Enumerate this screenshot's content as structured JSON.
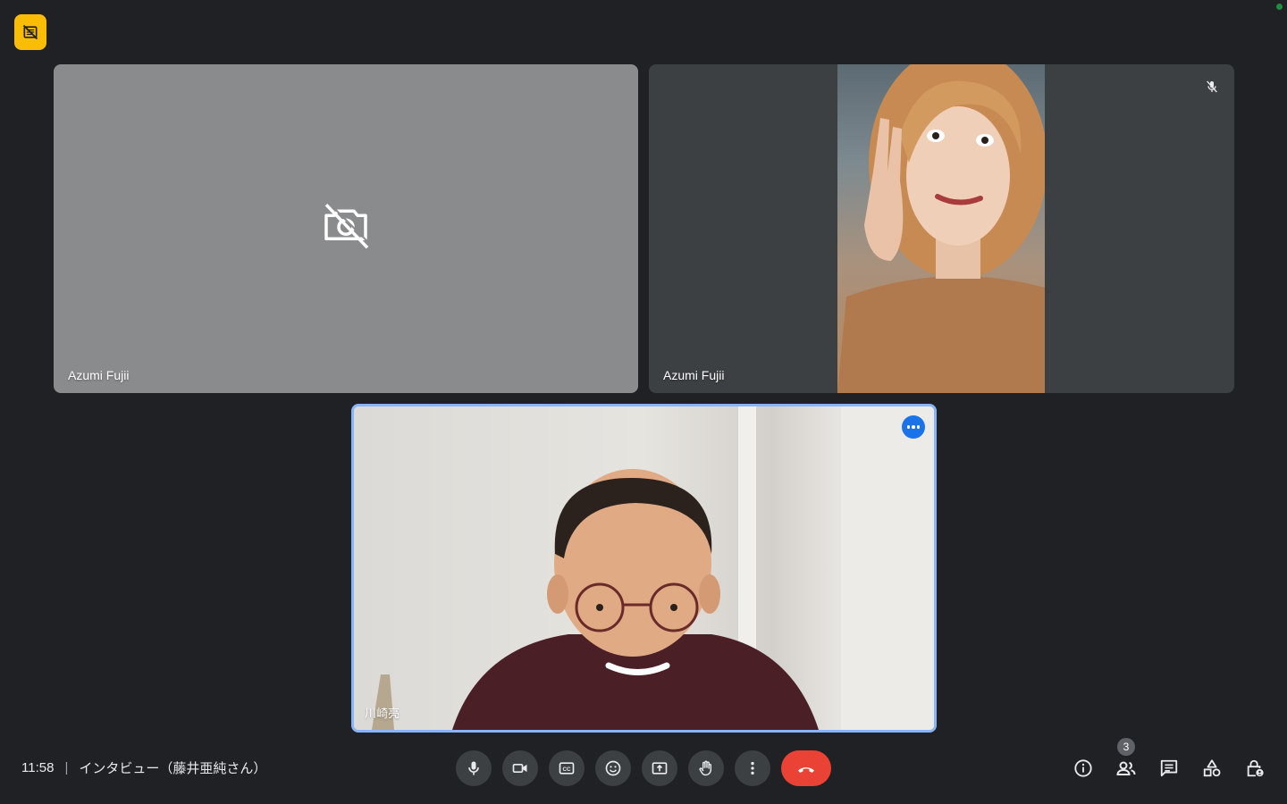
{
  "meeting": {
    "time": "11:58",
    "separator": "|",
    "title": "インタビュー（藤井亜純さん）"
  },
  "tiles": [
    {
      "name": "Azumi Fujii",
      "camera": "off"
    },
    {
      "name": "Azumi Fujii",
      "mic": "muted"
    },
    {
      "name": "川崎亮",
      "active_speaker": true
    }
  ],
  "controls": [
    {
      "name": "microphone",
      "icon": "mic-icon"
    },
    {
      "name": "camera",
      "icon": "videocam-icon"
    },
    {
      "name": "captions",
      "icon": "closed-caption-icon"
    },
    {
      "name": "reactions",
      "icon": "emoji-icon"
    },
    {
      "name": "present",
      "icon": "present-screen-icon"
    },
    {
      "name": "raise-hand",
      "icon": "hand-icon"
    },
    {
      "name": "more-options",
      "icon": "more-vert-icon"
    },
    {
      "name": "leave-call",
      "icon": "call-end-icon"
    }
  ],
  "side_controls": {
    "people_count": "3"
  },
  "colors": {
    "background": "#202124",
    "control": "#3c4043",
    "end_call": "#ea4335",
    "active_border": "#8ab4f8",
    "badge": "#fbbc04",
    "recording": "#1e8e3e"
  }
}
